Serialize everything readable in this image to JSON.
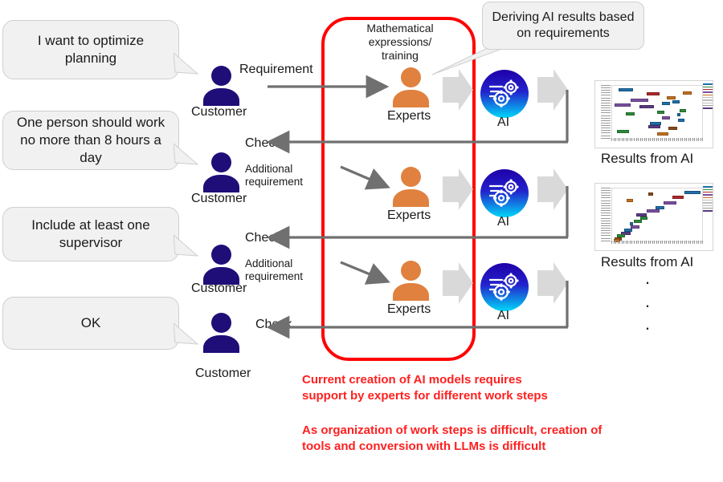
{
  "diagram": {
    "customer_rows": [
      {
        "bubble_text": "I want to optimize planning",
        "person_label": "Customer",
        "action_label": "Requirement",
        "action_note": ""
      },
      {
        "bubble_text": "One person should work no more than 8 hours a day",
        "person_label": "Customer",
        "action_label": "Check",
        "action_note": "Additional requirement"
      },
      {
        "bubble_text": "Include at least one supervisor",
        "person_label": "Customer",
        "action_label": "Check",
        "action_note": "Additional requirement"
      },
      {
        "bubble_text": "OK",
        "person_label": "Customer",
        "action_label": "Check",
        "action_note": ""
      }
    ],
    "process_rows": [
      {
        "expert_label": "Experts",
        "ai_label": "AI"
      },
      {
        "expert_label": "Experts",
        "ai_label": "AI"
      },
      {
        "expert_label": "Experts",
        "ai_label": "AI"
      }
    ],
    "expert_header": "Mathematical expressions/ training",
    "callout_text": "Deriving AI results based on requirements",
    "results": [
      {
        "caption": "Results from AI"
      },
      {
        "caption": "Results from AI"
      }
    ],
    "ellipsis": "·",
    "notes": [
      "Current creation of AI models requires support by experts for different work steps",
      "As organization of work steps is difficult, creation of tools and conversion with LLMs is difficult"
    ],
    "colors": {
      "customer": "#1f0d78",
      "expert": "#e0813f",
      "red_frame": "#ff0000",
      "note_red": "#ff2020",
      "arrow_gray": "#707070",
      "block_arrow": "#d9d9d9",
      "bubble_bg": "#f1f1f1"
    }
  },
  "chart_data": [
    {
      "type": "bar",
      "title": "Results from AI",
      "xlabel": "",
      "ylabel": "",
      "orientation": "horizontal-gantt",
      "categories": [
        "t1",
        "t2",
        "t3",
        "t4",
        "t5",
        "t6",
        "t7",
        "t8",
        "t9",
        "t10",
        "t11",
        "t12",
        "t13",
        "t14",
        "t15",
        "t16",
        "t17",
        "t18",
        "t19"
      ],
      "bars": [
        {
          "x": 7,
          "y": 5,
          "w": 16,
          "color": "#1f6fa8"
        },
        {
          "x": 38,
          "y": 12,
          "w": 14,
          "color": "#b02828"
        },
        {
          "x": 78,
          "y": 10,
          "w": 10,
          "color": "#c4701e"
        },
        {
          "x": 60,
          "y": 20,
          "w": 10,
          "color": "#c4701e"
        },
        {
          "x": 20,
          "y": 25,
          "w": 20,
          "color": "#7a4fa0"
        },
        {
          "x": 2,
          "y": 33,
          "w": 18,
          "color": "#7a4fa0"
        },
        {
          "x": 30,
          "y": 36,
          "w": 16,
          "color": "#5a3a85"
        },
        {
          "x": 55,
          "y": 30,
          "w": 9,
          "color": "#1f6fa8"
        },
        {
          "x": 67,
          "y": 27,
          "w": 8,
          "color": "#1f6fa8"
        },
        {
          "x": 15,
          "y": 50,
          "w": 10,
          "color": "#2e8b3a"
        },
        {
          "x": 50,
          "y": 47,
          "w": 8,
          "color": "#2e8b3a"
        },
        {
          "x": 75,
          "y": 44,
          "w": 7,
          "color": "#2e8b3a"
        },
        {
          "x": 72,
          "y": 52,
          "w": 4,
          "color": "#1f6fa8"
        },
        {
          "x": 55,
          "y": 58,
          "w": 9,
          "color": "#7a4fa0"
        },
        {
          "x": 73,
          "y": 62,
          "w": 7,
          "color": "#1f6fa8"
        },
        {
          "x": 42,
          "y": 68,
          "w": 12,
          "color": "#1f6fa8"
        },
        {
          "x": 40,
          "y": 74,
          "w": 13,
          "color": "#5a3a85"
        },
        {
          "x": 62,
          "y": 77,
          "w": 10,
          "color": "#8a4a18"
        },
        {
          "x": 5,
          "y": 84,
          "w": 13,
          "color": "#2e8b3a"
        },
        {
          "x": 50,
          "y": 88,
          "w": 12,
          "color": "#c4701e"
        }
      ],
      "legend_colors": [
        "#1f6fa8",
        "#2e8b3a",
        "#b02828",
        "#7a4fa0",
        "#c4701e",
        "#bdbdbd",
        "#bdbdbd",
        "#bdbdbd",
        "#9a9a9a",
        "#5a3a85"
      ]
    },
    {
      "type": "bar",
      "title": "Results from AI",
      "xlabel": "",
      "ylabel": "",
      "orientation": "horizontal-gantt",
      "categories": [
        "t1",
        "t2",
        "t3",
        "t4",
        "t5",
        "t6",
        "t7",
        "t8",
        "t9",
        "t10",
        "t11",
        "t12",
        "t13",
        "t14",
        "t15",
        "t16",
        "t17",
        "t18"
      ],
      "bars": [
        {
          "x": 80,
          "y": 4,
          "w": 18,
          "color": "#1f6fa8"
        },
        {
          "x": 40,
          "y": 8,
          "w": 5,
          "color": "#8a4a18"
        },
        {
          "x": 67,
          "y": 14,
          "w": 12,
          "color": "#b02828"
        },
        {
          "x": 16,
          "y": 20,
          "w": 7,
          "color": "#c4701e"
        },
        {
          "x": 57,
          "y": 25,
          "w": 14,
          "color": "#7a4fa0"
        },
        {
          "x": 48,
          "y": 33,
          "w": 10,
          "color": "#1f6fa8"
        },
        {
          "x": 38,
          "y": 40,
          "w": 14,
          "color": "#7a4fa0"
        },
        {
          "x": 26,
          "y": 47,
          "w": 12,
          "color": "#5a3a85"
        },
        {
          "x": 31,
          "y": 53,
          "w": 8,
          "color": "#2e8b3a"
        },
        {
          "x": 24,
          "y": 59,
          "w": 9,
          "color": "#2e8b3a"
        },
        {
          "x": 19,
          "y": 64,
          "w": 4,
          "color": "#1f6fa8"
        },
        {
          "x": 20,
          "y": 70,
          "w": 10,
          "color": "#7a4fa0"
        },
        {
          "x": 13,
          "y": 76,
          "w": 9,
          "color": "#1f6fa8"
        },
        {
          "x": 9,
          "y": 82,
          "w": 11,
          "color": "#5a3a85"
        },
        {
          "x": 5,
          "y": 87,
          "w": 9,
          "color": "#2e8b3a"
        },
        {
          "x": 2,
          "y": 92,
          "w": 8,
          "color": "#8a4a18"
        },
        {
          "x": 1,
          "y": 96,
          "w": 7,
          "color": "#c4701e"
        }
      ],
      "legend_colors": [
        "#1f6fa8",
        "#2e8b3a",
        "#b02828",
        "#7a4fa0",
        "#c4701e",
        "#bdbdbd",
        "#bdbdbd",
        "#bdbdbd",
        "#9a9a9a",
        "#5a3a85"
      ]
    }
  ]
}
